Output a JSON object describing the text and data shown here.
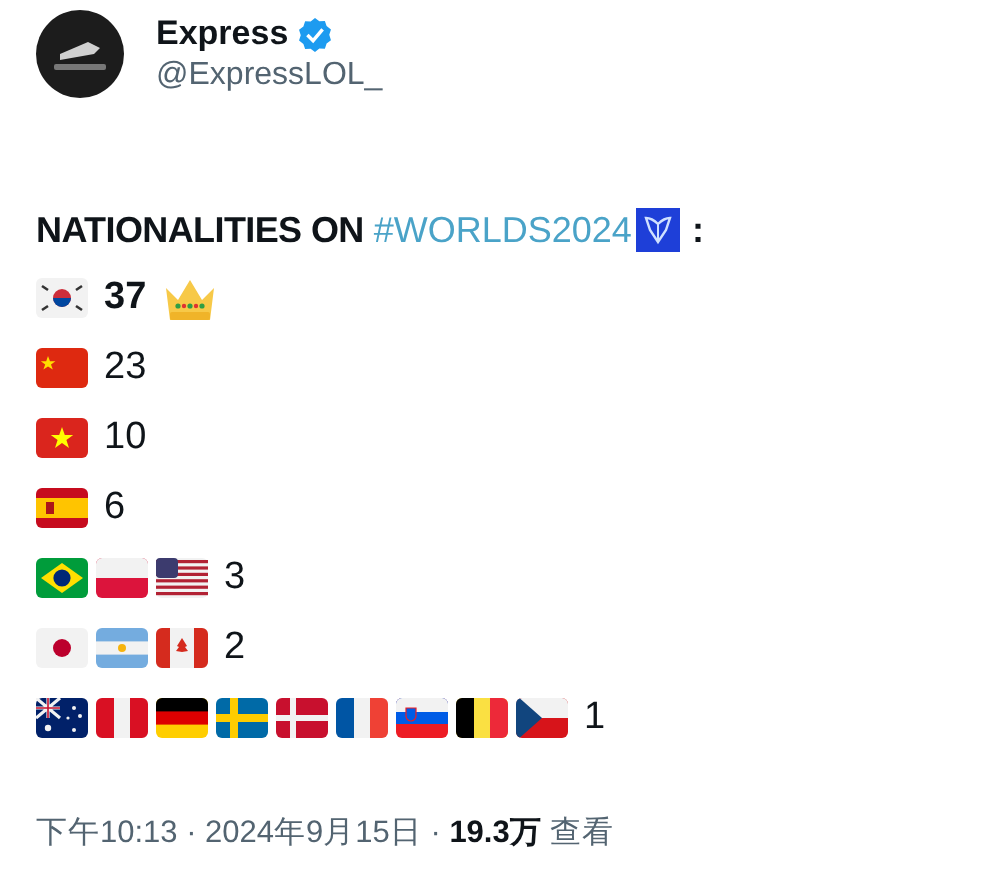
{
  "author": {
    "name": "Express",
    "verified": true,
    "handle": "@ExpressLOL_"
  },
  "heading": {
    "text": "NATIONALITIES ON",
    "hashtag": "#WORLDS2024",
    "colon": ":"
  },
  "rows": [
    {
      "kind": "top",
      "flags": [
        {
          "kind": "kr"
        }
      ],
      "count": "37"
    },
    {
      "kind": "normal",
      "flags": [
        {
          "kind": "cn"
        }
      ],
      "count": "23"
    },
    {
      "kind": "normal",
      "flags": [
        {
          "kind": "vn"
        }
      ],
      "count": "10"
    },
    {
      "kind": "normal",
      "flags": [
        {
          "kind": "es"
        }
      ],
      "count": "6"
    },
    {
      "kind": "normal",
      "flags": [
        {
          "kind": "br"
        },
        {
          "kind": "pl"
        },
        {
          "kind": "us"
        }
      ],
      "count": "3"
    },
    {
      "kind": "normal",
      "flags": [
        {
          "kind": "jp"
        },
        {
          "kind": "ar"
        },
        {
          "kind": "ca"
        }
      ],
      "count": "2"
    },
    {
      "kind": "normal",
      "flags": [
        {
          "kind": "au"
        },
        {
          "kind": "pe"
        },
        {
          "kind": "de"
        },
        {
          "kind": "se"
        },
        {
          "kind": "dk"
        },
        {
          "kind": "fr"
        },
        {
          "kind": "si"
        },
        {
          "kind": "be"
        },
        {
          "kind": "cz"
        }
      ],
      "count": "1"
    }
  ],
  "footer": "下午10:13 · 2024年9月15日 · **19.3万** 查看"
}
